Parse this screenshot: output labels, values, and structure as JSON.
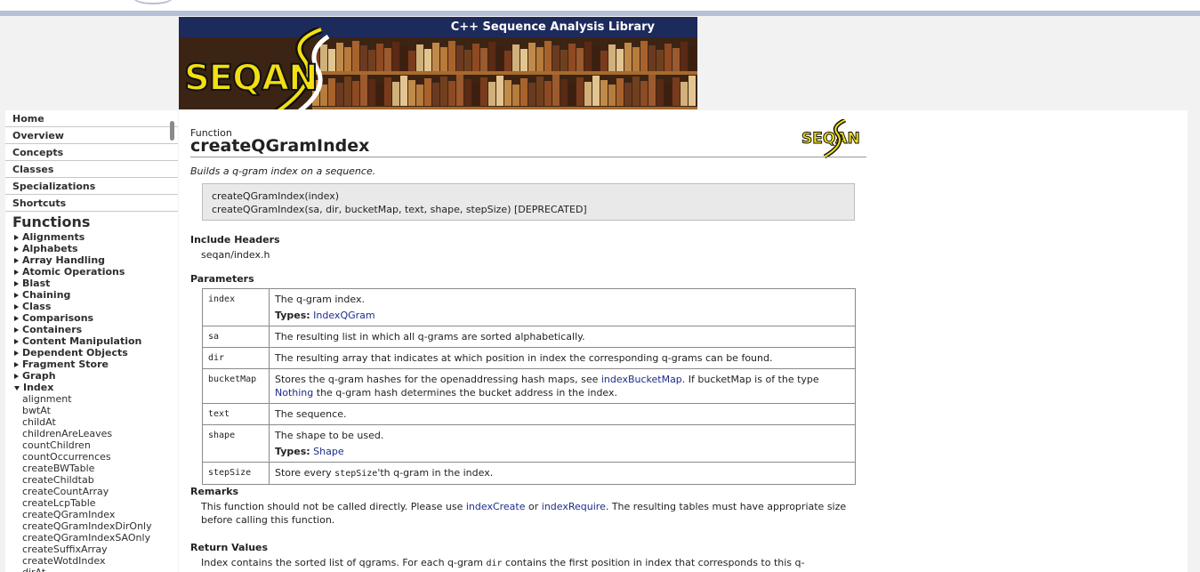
{
  "banner": {
    "title": "C++ Sequence Analysis Library",
    "logo_text": "SEQAN"
  },
  "sidebar": {
    "nav": [
      "Home",
      "Overview",
      "Concepts",
      "Classes",
      "Specializations",
      "Shortcuts"
    ],
    "section_title": "Functions",
    "categories": [
      "Alignments",
      "Alphabets",
      "Array Handling",
      "Atomic Operations",
      "Blast",
      "Chaining",
      "Class",
      "Comparisons",
      "Containers",
      "Content Manipulation",
      "Dependent Objects",
      "Fragment Store",
      "Graph",
      "Index"
    ],
    "index_items": [
      "alignment",
      "bwtAt",
      "childAt",
      "childrenAreLeaves",
      "countChildren",
      "countOccurrences",
      "createBWTable",
      "createChildtab",
      "createCountArray",
      "createLcpTable",
      "createQGramIndex",
      "createQGramIndexDirOnly",
      "createQGramIndexSAOnly",
      "createSuffixArray",
      "createWotdIndex",
      "dirAt"
    ]
  },
  "main": {
    "kind": "Function",
    "name": "createQGramIndex",
    "logo_text": "SEQAN",
    "summary": "Builds a q-gram index on a sequence.",
    "signatures": [
      "createQGramIndex(index)",
      "createQGramIndex(sa, dir, bucketMap, text, shape, stepSize) [DEPRECATED]"
    ],
    "include": {
      "heading": "Include Headers",
      "value": "seqan/index.h"
    },
    "params_heading": "Parameters",
    "types_label": "Types:",
    "params": {
      "index": {
        "name": "index",
        "desc": "The q-gram index.",
        "type": "IndexQGram"
      },
      "sa": {
        "name": "sa",
        "desc": "The resulting list in which all q-grams are sorted alphabetically."
      },
      "dir": {
        "name": "dir",
        "desc": "The resulting array that indicates at which position in index the corresponding q-grams can be found."
      },
      "bucketMap": {
        "name": "bucketMap",
        "desc1": "Stores the q-gram hashes for the openaddressing hash maps, see ",
        "link1": "indexBucketMap",
        "desc2": ". If bucketMap is of the type ",
        "link2": "Nothing",
        "desc3": " the q-gram hash determines the bucket address in the index."
      },
      "text": {
        "name": "text",
        "desc": "The sequence."
      },
      "shape": {
        "name": "shape",
        "desc": "The shape to be used.",
        "type": "Shape"
      },
      "stepSize": {
        "name": "stepSize",
        "desc1": "Store every ",
        "code": "stepSize",
        "desc2": "'th q-gram in the index."
      }
    },
    "remarks": {
      "heading": "Remarks",
      "text1": "This function should not be called directly. Please use ",
      "link1": "indexCreate",
      "text2": " or ",
      "link2": "indexRequire",
      "text3": ". The resulting tables must have appropriate size before calling this function."
    },
    "returns": {
      "heading": "Return Values",
      "text1": "Index contains the sorted list of qgrams. For each q-gram ",
      "code": "dir",
      "text2": " contains the first position in index that corresponds to this q-"
    }
  }
}
